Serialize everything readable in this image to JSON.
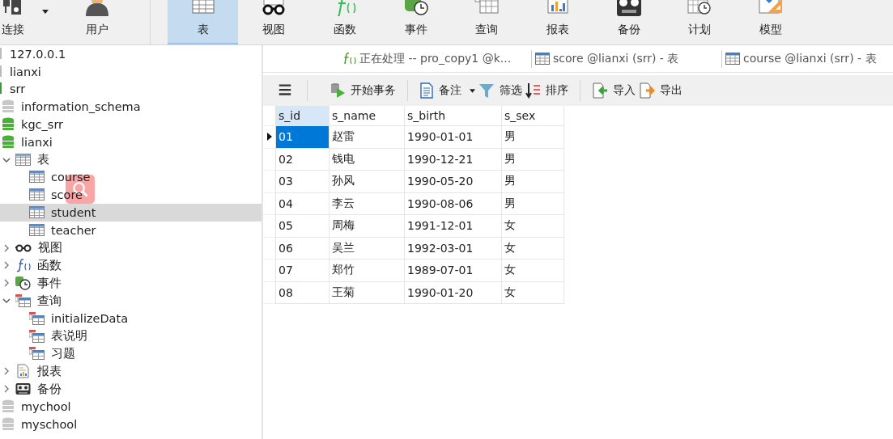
{
  "toolbar": [
    {
      "label": "连接",
      "kind": "connect",
      "selected": false,
      "dropdown": true
    },
    {
      "label": "用户",
      "kind": "user",
      "selected": false,
      "dropdown": false
    },
    {
      "label": "表",
      "kind": "table",
      "selected": true,
      "dropdown": false
    },
    {
      "label": "视图",
      "kind": "view",
      "selected": false,
      "dropdown": false
    },
    {
      "label": "函数",
      "kind": "function",
      "selected": false,
      "dropdown": false
    },
    {
      "label": "事件",
      "kind": "event",
      "selected": false,
      "dropdown": false
    },
    {
      "label": "查询",
      "kind": "query",
      "selected": false,
      "dropdown": false
    },
    {
      "label": "报表",
      "kind": "report",
      "selected": false,
      "dropdown": false
    },
    {
      "label": "备份",
      "kind": "backup",
      "selected": false,
      "dropdown": false
    },
    {
      "label": "计划",
      "kind": "schedule",
      "selected": false,
      "dropdown": false
    },
    {
      "label": "模型",
      "kind": "model",
      "selected": false,
      "dropdown": false
    }
  ],
  "sidebar": {
    "items": [
      {
        "label": "127.0.0.1",
        "kind": "connection",
        "active": false,
        "selected": false
      },
      {
        "label": "lianxi",
        "kind": "connection",
        "active": false,
        "selected": false
      },
      {
        "label": "srr",
        "kind": "connection",
        "active": true,
        "selected": false,
        "children": [
          {
            "label": "information_schema",
            "kind": "database",
            "active": false,
            "selected": false
          },
          {
            "label": "kgc_srr",
            "kind": "database",
            "active": true,
            "selected": false
          },
          {
            "label": "lianxi",
            "kind": "database",
            "active": true,
            "selected": false,
            "children": [
              {
                "label": "表",
                "kind": "tables",
                "expanded": true,
                "selected": false,
                "children": [
                  {
                    "label": "course",
                    "kind": "table",
                    "selected": false
                  },
                  {
                    "label": "score",
                    "kind": "table",
                    "selected": false
                  },
                  {
                    "label": "student",
                    "kind": "table",
                    "selected": true
                  },
                  {
                    "label": "teacher",
                    "kind": "table",
                    "selected": false
                  }
                ]
              },
              {
                "label": "视图",
                "kind": "views",
                "expanded": false,
                "selected": false
              },
              {
                "label": "函数",
                "kind": "functions",
                "expanded": false,
                "selected": false
              },
              {
                "label": "事件",
                "kind": "events",
                "expanded": false,
                "selected": false
              },
              {
                "label": "查询",
                "kind": "queries",
                "expanded": true,
                "selected": false,
                "children": [
                  {
                    "label": "initializeData",
                    "kind": "query",
                    "selected": false
                  },
                  {
                    "label": "表说明",
                    "kind": "query",
                    "selected": false
                  },
                  {
                    "label": "习题",
                    "kind": "query",
                    "selected": false
                  }
                ]
              },
              {
                "label": "报表",
                "kind": "reports",
                "expanded": false,
                "selected": false
              },
              {
                "label": "备份",
                "kind": "backups",
                "expanded": false,
                "selected": false
              }
            ]
          },
          {
            "label": "mychool",
            "kind": "database",
            "active": false,
            "selected": false
          },
          {
            "label": "myschool",
            "kind": "database",
            "active": false,
            "selected": false
          }
        ]
      }
    ]
  },
  "tabs": [
    {
      "label": "正在处理 -- pro_copy1 @k...",
      "kind": "function"
    },
    {
      "label": "score @lianxi (srr) - 表",
      "kind": "table"
    },
    {
      "label": "course @lianxi (srr) - 表",
      "kind": "table"
    }
  ],
  "action_groups": [
    [
      {
        "kind": "menu",
        "dropdown": false
      }
    ],
    [
      {
        "label": "开始事务",
        "kind": "begin",
        "dropdown": false
      }
    ],
    [
      {
        "label": "备注",
        "kind": "note",
        "dropdown": true
      },
      {
        "label": "筛选",
        "kind": "filter",
        "dropdown": false
      },
      {
        "label": "排序",
        "kind": "sort",
        "dropdown": false
      }
    ],
    [
      {
        "label": "导入",
        "kind": "import",
        "dropdown": false
      },
      {
        "label": "导出",
        "kind": "export",
        "dropdown": false
      }
    ]
  ],
  "table": {
    "columns": [
      {
        "label": "s_id",
        "selected": true
      },
      {
        "label": "s_name",
        "selected": false
      },
      {
        "label": "s_birth",
        "selected": false
      },
      {
        "label": "s_sex",
        "selected": false
      }
    ],
    "rows": [
      {
        "selected": true,
        "cells": [
          "01",
          "赵雷",
          "1990-01-01",
          "男"
        ]
      },
      {
        "selected": false,
        "cells": [
          "02",
          "钱电",
          "1990-12-21",
          "男"
        ]
      },
      {
        "selected": false,
        "cells": [
          "03",
          "孙风",
          "1990-05-20",
          "男"
        ]
      },
      {
        "selected": false,
        "cells": [
          "04",
          "李云",
          "1990-08-06",
          "男"
        ]
      },
      {
        "selected": false,
        "cells": [
          "05",
          "周梅",
          "1991-12-01",
          "女"
        ]
      },
      {
        "selected": false,
        "cells": [
          "06",
          "吴兰",
          "1992-03-01",
          "女"
        ]
      },
      {
        "selected": false,
        "cells": [
          "07",
          "郑竹",
          "1989-07-01",
          "女"
        ]
      },
      {
        "selected": false,
        "cells": [
          "08",
          "王菊",
          "1990-01-20",
          "女"
        ]
      }
    ]
  }
}
